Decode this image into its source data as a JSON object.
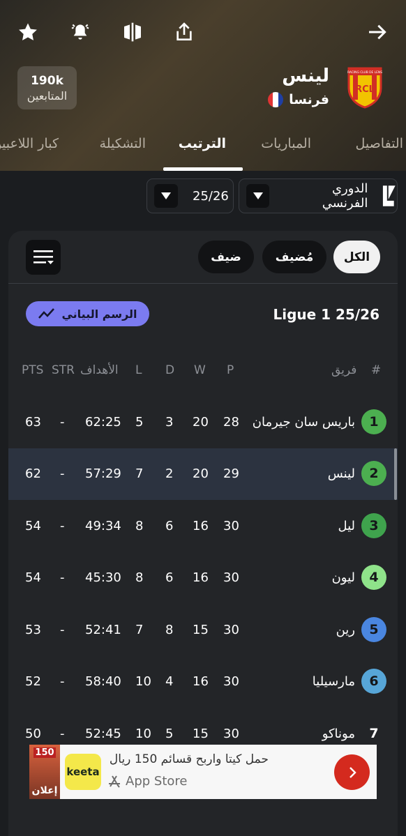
{
  "header": {
    "team_name": "لينس",
    "country": "فرنسا",
    "followers_count": "190k",
    "followers_label": "المتابعين",
    "crest_text": "RCL",
    "crest_caption": "RACING CLUB DE LENS"
  },
  "tabs": [
    {
      "label": "التفاصيل"
    },
    {
      "label": "المباريات"
    },
    {
      "label": "الترتيب"
    },
    {
      "label": "التشكيلة"
    },
    {
      "label": "كبار اللاعبين"
    }
  ],
  "selectors": {
    "league": "الدوري الفرنسي",
    "season": "25/26"
  },
  "filters": {
    "all": "الكل",
    "home": "مُضيف",
    "away": "ضيف"
  },
  "standings": {
    "title": "Ligue 1 25/26",
    "chart_button": "الرسم البياني",
    "columns": {
      "rank": "#",
      "team": "فريق",
      "played": "P",
      "won": "W",
      "drawn": "D",
      "lost": "L",
      "goals": "الأهداف",
      "streak": "STR",
      "points": "PTS"
    },
    "rows": [
      {
        "rank": "1",
        "team": "باريس سان جيرمان",
        "p": "28",
        "w": "20",
        "d": "3",
        "l": "5",
        "goals": "62:25",
        "str": "-",
        "pts": "63"
      },
      {
        "rank": "2",
        "team": "لينس",
        "p": "29",
        "w": "20",
        "d": "2",
        "l": "7",
        "goals": "57:29",
        "str": "-",
        "pts": "62"
      },
      {
        "rank": "3",
        "team": "ليل",
        "p": "30",
        "w": "16",
        "d": "6",
        "l": "8",
        "goals": "49:34",
        "str": "-",
        "pts": "54"
      },
      {
        "rank": "4",
        "team": "ليون",
        "p": "30",
        "w": "16",
        "d": "6",
        "l": "8",
        "goals": "45:30",
        "str": "-",
        "pts": "54"
      },
      {
        "rank": "5",
        "team": "رين",
        "p": "30",
        "w": "15",
        "d": "8",
        "l": "7",
        "goals": "52:41",
        "str": "-",
        "pts": "53"
      },
      {
        "rank": "6",
        "team": "مارسيليا",
        "p": "30",
        "w": "16",
        "d": "4",
        "l": "10",
        "goals": "58:40",
        "str": "-",
        "pts": "52"
      },
      {
        "rank": "7",
        "team": "موناكو",
        "p": "30",
        "w": "15",
        "d": "5",
        "l": "10",
        "goals": "52:45",
        "str": "-",
        "pts": "50"
      }
    ],
    "rank_colors": [
      "#4caf50",
      "#4caf50",
      "#3fa34d",
      "#8fe38a",
      "#4a86e0",
      "#57a6d8",
      ""
    ]
  },
  "ad": {
    "badge_number": "150",
    "label": "إعلان",
    "logo_text": "keeta",
    "title": "حمل كيتا واربح قسائم 150 ريال",
    "store": "App Store"
  }
}
